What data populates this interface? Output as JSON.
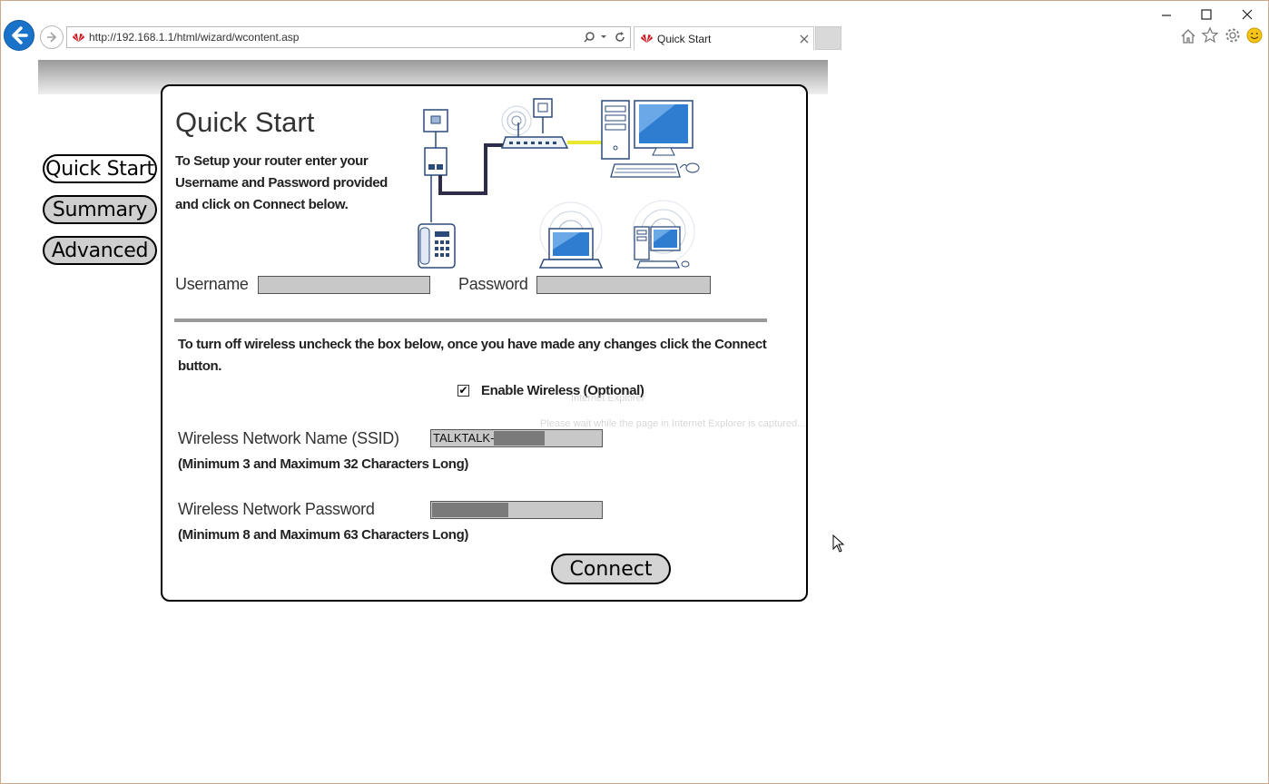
{
  "browser": {
    "url": "http://192.168.1.1/html/wizard/wcontent.asp",
    "tab_title": "Quick Start"
  },
  "sidebar": {
    "items": [
      {
        "label": "Quick Start"
      },
      {
        "label": "Summary"
      },
      {
        "label": "Advanced"
      }
    ]
  },
  "panel": {
    "title": "Quick Start",
    "intro": "To Setup your router enter your Username and Password provided and click on Connect below.",
    "username_label": "Username",
    "password_label": "Password",
    "username_value": "",
    "password_value": "",
    "wireless_instructions": "To turn off wireless uncheck the box below, once you have made any changes click the Connect button.",
    "enable_wireless_label": "Enable Wireless (Optional)",
    "enable_wireless_checked": true,
    "ssid_label": "Wireless Network Name (SSID)",
    "ssid_value": "TALKTALK-",
    "ssid_hint": "(Minimum 3 and Maximum 32 Characters Long)",
    "wifi_password_label": "Wireless Network Password",
    "wifi_password_hint": "(Minimum 8 and Maximum 63 Characters Long)",
    "connect_label": "Connect"
  },
  "overlay": {
    "ghost_title": "Internet Explorer",
    "ghost_message": "Please wait while the page in Internet Explorer is captured..."
  },
  "colors": {
    "back_button": "#1a73c9",
    "field_bg": "#c8c8c8",
    "brand_red": "#d0121b"
  }
}
